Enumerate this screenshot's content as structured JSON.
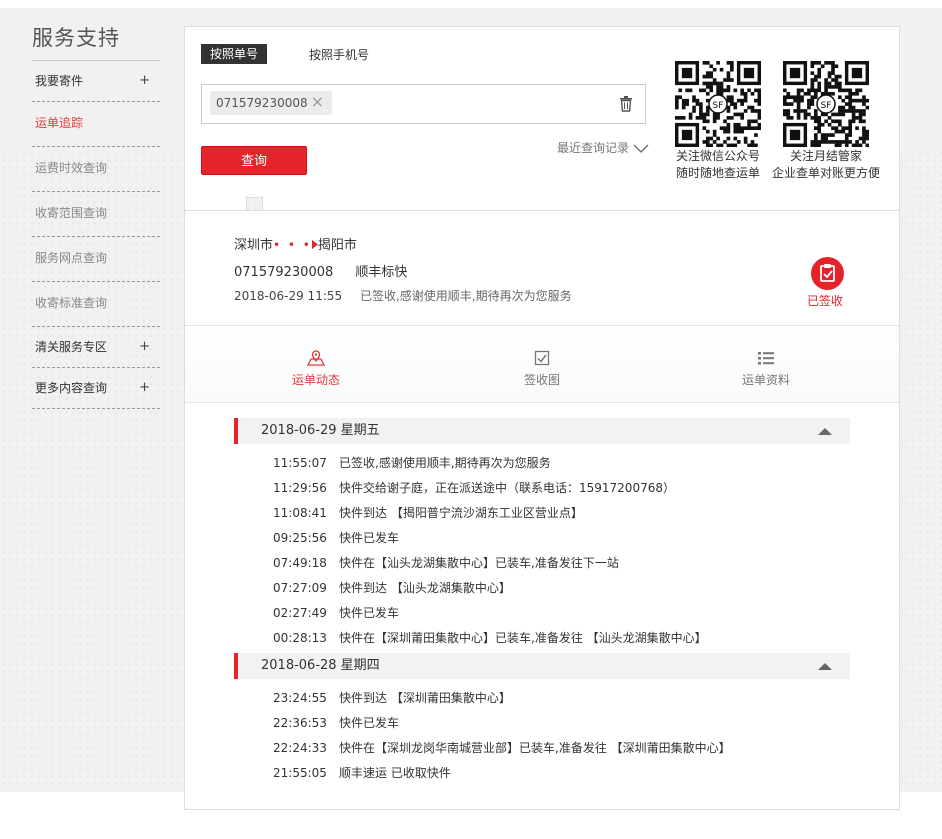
{
  "sidebar": {
    "title": "服务支持",
    "items": [
      {
        "label": "我要寄件",
        "plus": "+"
      },
      {
        "label": "运单追踪"
      },
      {
        "label": "运费时效查询"
      },
      {
        "label": "收寄范围查询"
      },
      {
        "label": "服务网点查询"
      },
      {
        "label": "收寄标准查询"
      },
      {
        "label": "清关服务专区",
        "plus": "+"
      },
      {
        "label": "更多内容查询",
        "plus": "+"
      }
    ]
  },
  "search": {
    "tab_waybill": "按照单号",
    "tab_phone": "按照手机号",
    "chip_value": "071579230008",
    "chip_close": "×",
    "recent_label": "最近查询记录",
    "query_button": "查询",
    "qr1_caption1": "关注微信公众号",
    "qr1_caption2": "随时随地查运单",
    "qr2_caption1": "关注月结管家",
    "qr2_caption2": "企业查单对账更方便"
  },
  "result": {
    "from_city": "深圳市",
    "route_dots": "• • •",
    "to_city": "揭阳市",
    "waybill_no": "071579230008",
    "service": "顺丰标快",
    "status_time": "2018-06-29 11:55",
    "status_msg": "已签收,感谢使用顺丰,期待再次为您服务",
    "signed_label": "已签收",
    "tabs": [
      "运单动态",
      "签收图",
      "运单资料"
    ],
    "days": [
      {
        "date": "2018-06-29 星期五",
        "events": [
          {
            "time": "11:55:07",
            "text": "已签收,感谢使用顺丰,期待再次为您服务"
          },
          {
            "time": "11:29:56",
            "text": "快件交给谢子庭，正在派送途中（联系电话：15917200768）"
          },
          {
            "time": "11:08:41",
            "text": "快件到达 【揭阳普宁流沙湖东工业区营业点】"
          },
          {
            "time": "09:25:56",
            "text": "快件已发车"
          },
          {
            "time": "07:49:18",
            "text": "快件在【汕头龙湖集散中心】已装车,准备发往下一站"
          },
          {
            "time": "07:27:09",
            "text": "快件到达 【汕头龙湖集散中心】"
          },
          {
            "time": "02:27:49",
            "text": "快件已发车"
          },
          {
            "time": "00:28:13",
            "text": "快件在【深圳莆田集散中心】已装车,准备发往 【汕头龙湖集散中心】"
          }
        ]
      },
      {
        "date": "2018-06-28 星期四",
        "events": [
          {
            "time": "23:24:55",
            "text": "快件到达 【深圳莆田集散中心】"
          },
          {
            "time": "22:36:53",
            "text": "快件已发车"
          },
          {
            "time": "22:24:33",
            "text": "快件在【深圳龙岗华南城营业部】已装车,准备发往 【深圳莆田集散中心】"
          },
          {
            "time": "21:55:05",
            "text": "顺丰速运 已收取快件"
          }
        ]
      }
    ]
  },
  "colors": {
    "accent": "#e4232a"
  }
}
